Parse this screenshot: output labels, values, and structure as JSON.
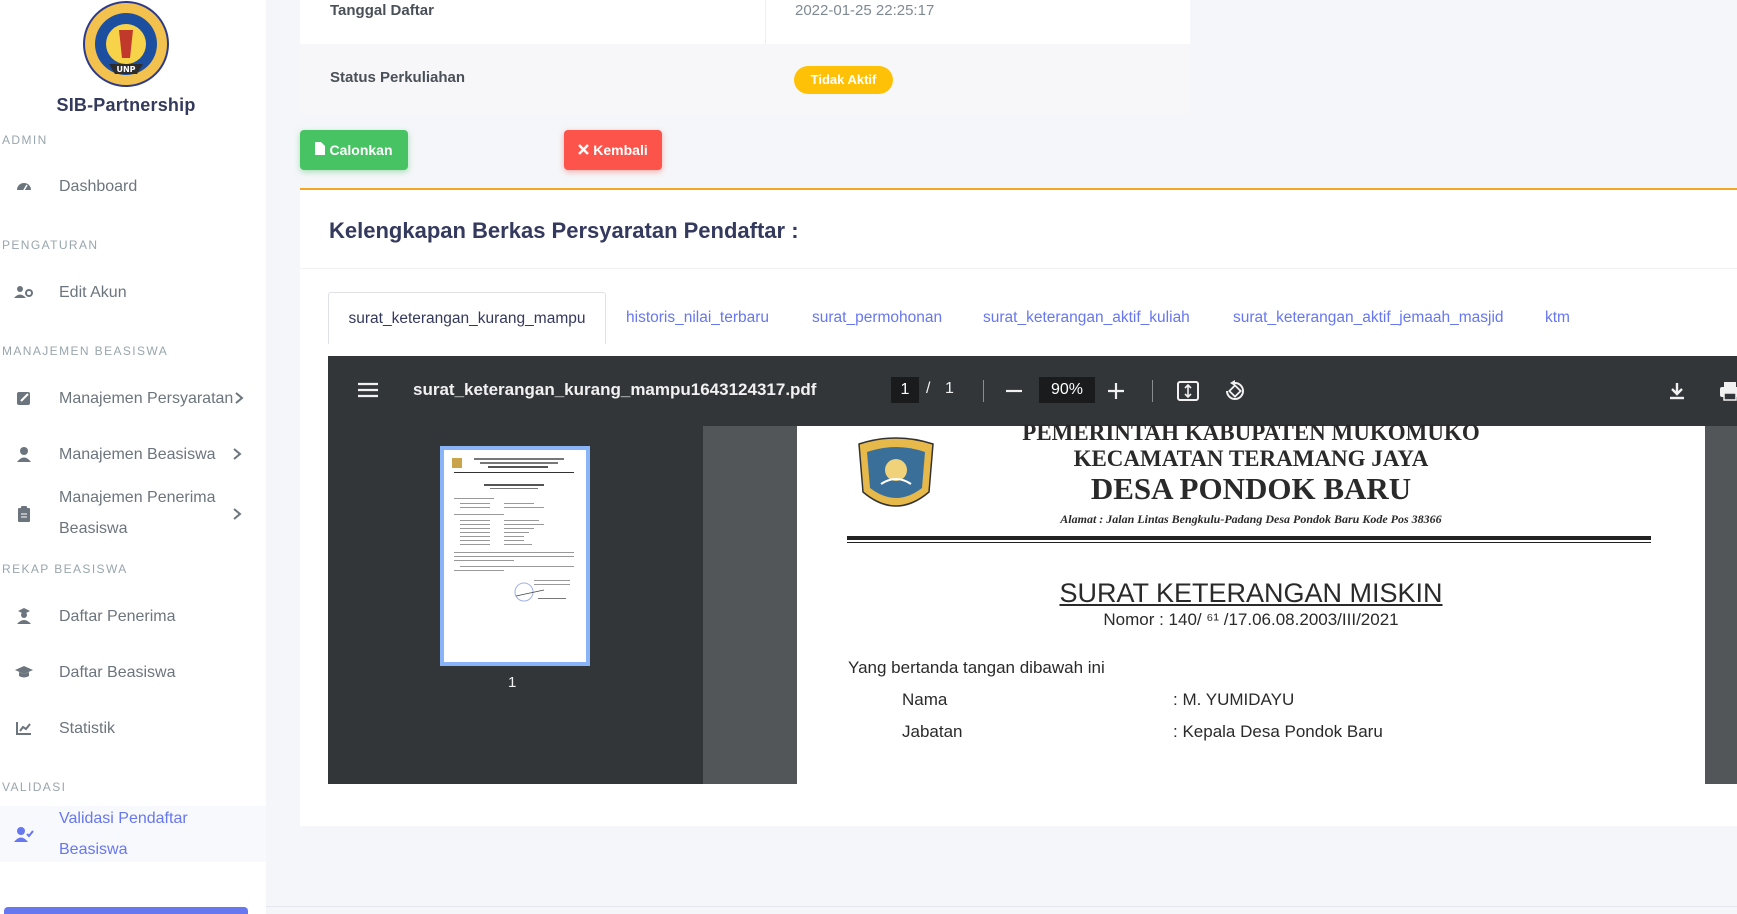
{
  "sidebar": {
    "brand": "SIB-Partnership",
    "logo_text": "UNIVERSITAS NEGERI PADANG UNP",
    "sections": {
      "admin": "ADMIN",
      "pengaturan": "PENGATURAN",
      "manajemen_beasiswa": "MANAJEMEN BEASISWA",
      "rekap_beasiswa": "REKAP BEASISWA",
      "validasi": "VALIDASI"
    },
    "items": [
      {
        "label": "Dashboard",
        "icon": "dashboard-icon"
      },
      {
        "label": "Edit Akun",
        "icon": "users-cog-icon"
      },
      {
        "label": "Manajemen Persyaratan",
        "icon": "edit-icon"
      },
      {
        "label": "Manajemen Beasiswa",
        "icon": "user-icon"
      },
      {
        "label_line1": "Manajemen Penerima",
        "label_line2": "Beasiswa",
        "icon": "clipboard-icon"
      },
      {
        "label": "Daftar Penerima",
        "icon": "user-graduate-icon"
      },
      {
        "label": "Daftar Beasiswa",
        "icon": "graduation-cap-icon"
      },
      {
        "label": "Statistik",
        "icon": "chart-line-icon"
      },
      {
        "label_line1": "Validasi Pendaftar",
        "label_line2": "Beasiswa",
        "icon": "user-check-icon",
        "active": true
      }
    ]
  },
  "info": {
    "tanggal_daftar_label": "Tanggal Daftar",
    "tanggal_daftar_value": "2022-01-25 22:25:17",
    "status_label": "Status Perkuliahan",
    "status_value": "Tidak Aktif",
    "status_color": "#ffc107"
  },
  "buttons": {
    "calonkan": "Calonkan",
    "kembali": "Kembali",
    "calonkan_color": "#47c363",
    "kembali_color": "#fc544b"
  },
  "berkas": {
    "title": "Kelengkapan Berkas Persyaratan Pendaftar :",
    "tabs": [
      "surat_keterangan_kurang_mampu",
      "historis_nilai_terbaru",
      "surat_permohonan",
      "surat_keterangan_aktif_kuliah",
      "surat_keterangan_aktif_jemaah_masjid",
      "ktm"
    ],
    "active_tab": 0
  },
  "pdf_viewer": {
    "filename": "surat_keterangan_kurang_mampu1643124317.pdf",
    "current_page": "1",
    "page_separator": "/",
    "total_pages": "1",
    "zoom": "90%",
    "thumbnail_label": "1",
    "document": {
      "header1": "PEMERINTAH KABUPATEN MUKOMUKO",
      "header2": "KECAMATAN TERAMANG JAYA",
      "header3": "DESA PONDOK BARU",
      "address": "Alamat : Jalan Lintas  Bengkulu-Padang Desa Pondok Baru Kode Pos 38366",
      "letter_title": "SURAT KETERANGAN MISKIN",
      "nomor": "Nomor : 140/  ⁶¹   /17.06.08.2003/III/2021",
      "intro": "Yang bertanda tangan dibawah ini",
      "fields": [
        {
          "label": "Nama",
          "value": ": M. YUMIDAYU"
        },
        {
          "label": "Jabatan",
          "value": ": Kepala Desa Pondok Baru"
        }
      ]
    }
  }
}
